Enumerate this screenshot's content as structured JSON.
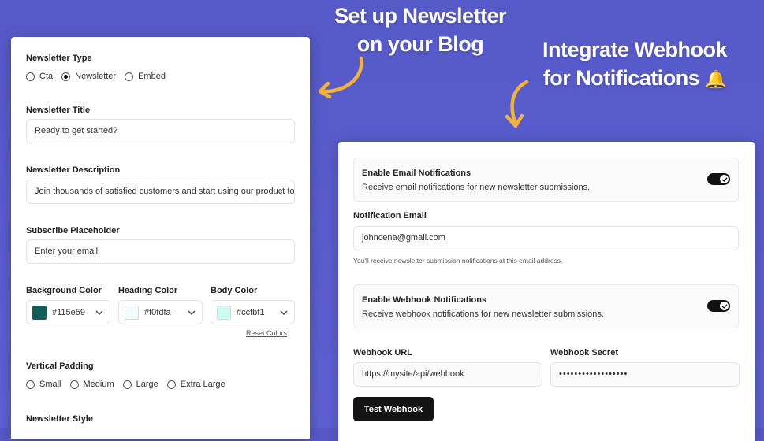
{
  "headlines": {
    "newsletter_line1": "Set up Newsletter",
    "newsletter_line2": "on your Blog",
    "webhook_line1": "Integrate Webhook",
    "webhook_line2": "for Notifications",
    "bell_emoji": "🔔"
  },
  "newsletter_form": {
    "type_label": "Newsletter Type",
    "type_options": [
      "Cta",
      "Newsletter",
      "Embed"
    ],
    "type_selected": "Newsletter",
    "title_label": "Newsletter Title",
    "title_value": "Ready to get started?",
    "description_label": "Newsletter Description",
    "description_value": "Join thousands of satisfied customers and start using our product today.",
    "placeholder_label": "Subscribe Placeholder",
    "placeholder_value": "Enter your email",
    "colors": [
      {
        "label": "Background Color",
        "value": "#115e59",
        "swatch": "#115e59"
      },
      {
        "label": "Heading Color",
        "value": "#f0fdfa",
        "swatch": "#f0fdfa"
      },
      {
        "label": "Body Color",
        "value": "#ccfbf1",
        "swatch": "#ccfbf1"
      }
    ],
    "reset_colors": "Reset Colors",
    "padding_label": "Vertical Padding",
    "padding_options": [
      "Small",
      "Medium",
      "Large",
      "Extra Large"
    ],
    "style_label": "Newsletter Style"
  },
  "notifications_form": {
    "email_toggle_title": "Enable Email Notifications",
    "email_toggle_desc": "Receive email notifications for new newsletter submissions.",
    "email_enabled": true,
    "email_label": "Notification Email",
    "email_value": "johncena@gmail.com",
    "email_hint": "You'll receive newsletter submission notifications at this email address.",
    "webhook_toggle_title": "Enable Webhook Notifications",
    "webhook_toggle_desc": "Receive webhook notifications for new newsletter submissions.",
    "webhook_enabled": true,
    "webhook_url_label": "Webhook URL",
    "webhook_url_value": "https://mysite/api/webhook",
    "webhook_secret_label": "Webhook Secret",
    "webhook_secret_value": "••••••••••••••••••",
    "test_button": "Test Webhook"
  },
  "colors": {
    "background": "#5b5fd0",
    "arrow": "#f2b33d",
    "toggle_on": "#111111",
    "button_dark": "#141414"
  }
}
